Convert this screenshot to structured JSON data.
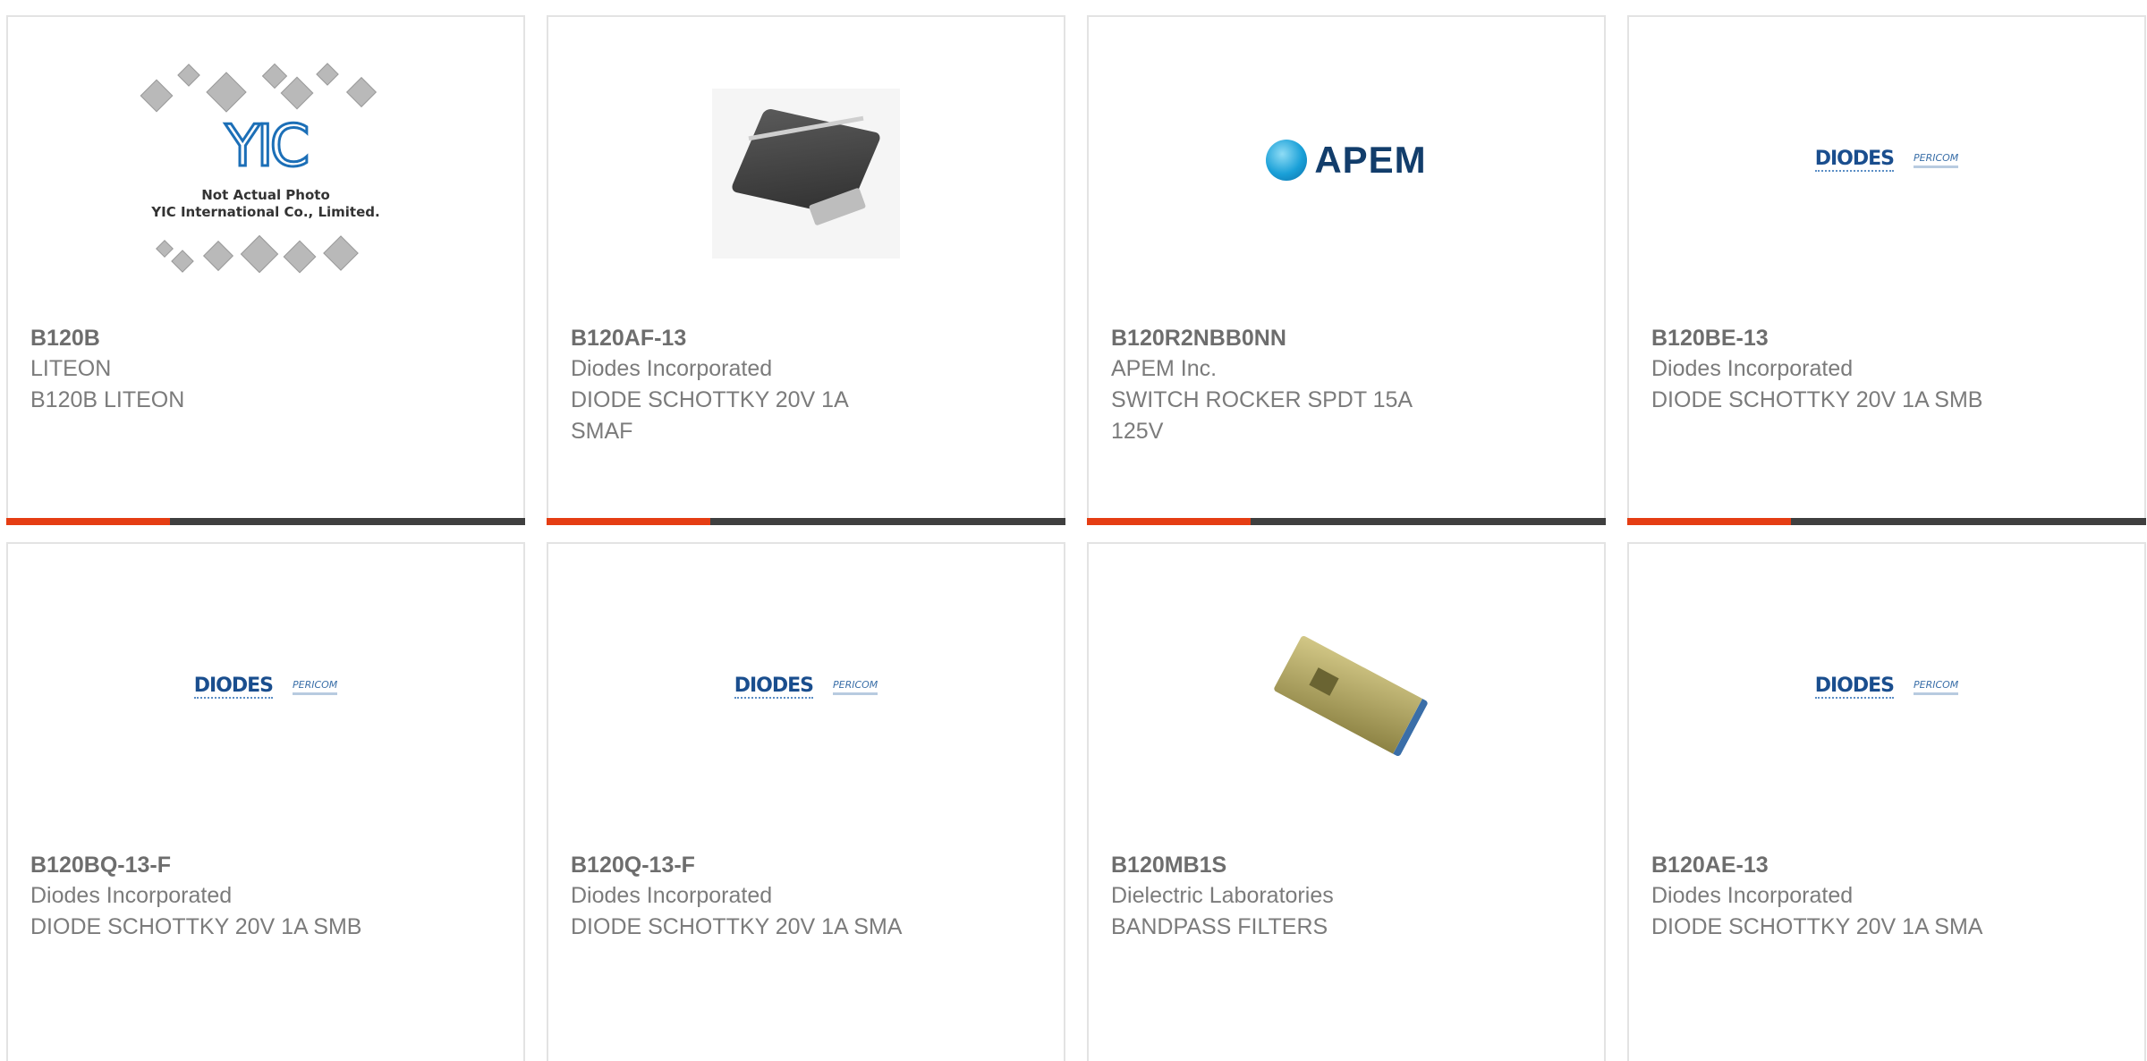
{
  "products": [
    {
      "part_number": "B120B",
      "manufacturer": "LITEON",
      "description": "B120B LITEON",
      "image": "not-actual-photo-placeholder",
      "image_caption": "Not Actual Photo\nYIC International Co., Limited.",
      "image_logo": "YIC"
    },
    {
      "part_number": "B120AF-13",
      "manufacturer": "Diodes Incorporated",
      "description": "DIODE SCHOTTKY 20V 1A SMAF",
      "image": "smaf-diode-photo"
    },
    {
      "part_number": "B120R2NBB0NN",
      "manufacturer": "APEM Inc.",
      "description": "SWITCH ROCKER SPDT 15A 125V",
      "image": "apem-logo",
      "image_logo": "APEM"
    },
    {
      "part_number": "B120BE-13",
      "manufacturer": "Diodes Incorporated",
      "description": "DIODE SCHOTTKY 20V 1A SMB",
      "image": "diodes-pericom-logo",
      "image_logo": "DIODES",
      "image_logo2": "PERICOM"
    },
    {
      "part_number": "B120BQ-13-F",
      "manufacturer": "Diodes Incorporated",
      "description": "DIODE SCHOTTKY 20V 1A SMB",
      "image": "diodes-pericom-logo",
      "image_logo": "DIODES",
      "image_logo2": "PERICOM"
    },
    {
      "part_number": "B120Q-13-F",
      "manufacturer": "Diodes Incorporated",
      "description": "DIODE SCHOTTKY 20V 1A SMA",
      "image": "diodes-pericom-logo",
      "image_logo": "DIODES",
      "image_logo2": "PERICOM"
    },
    {
      "part_number": "B120MB1S",
      "manufacturer": "Dielectric Laboratories",
      "description": "BANDPASS FILTERS",
      "image": "bandpass-filter-photo"
    },
    {
      "part_number": "B120AE-13",
      "manufacturer": "Diodes Incorporated",
      "description": "DIODE SCHOTTKY 20V 1A SMA",
      "image": "diodes-pericom-logo",
      "image_logo": "DIODES",
      "image_logo2": "PERICOM"
    }
  ],
  "colors": {
    "accent": "#e53d13",
    "bar": "#3f3f3f",
    "text_bold": "#6d6d6d",
    "text": "#7b7b7b"
  }
}
